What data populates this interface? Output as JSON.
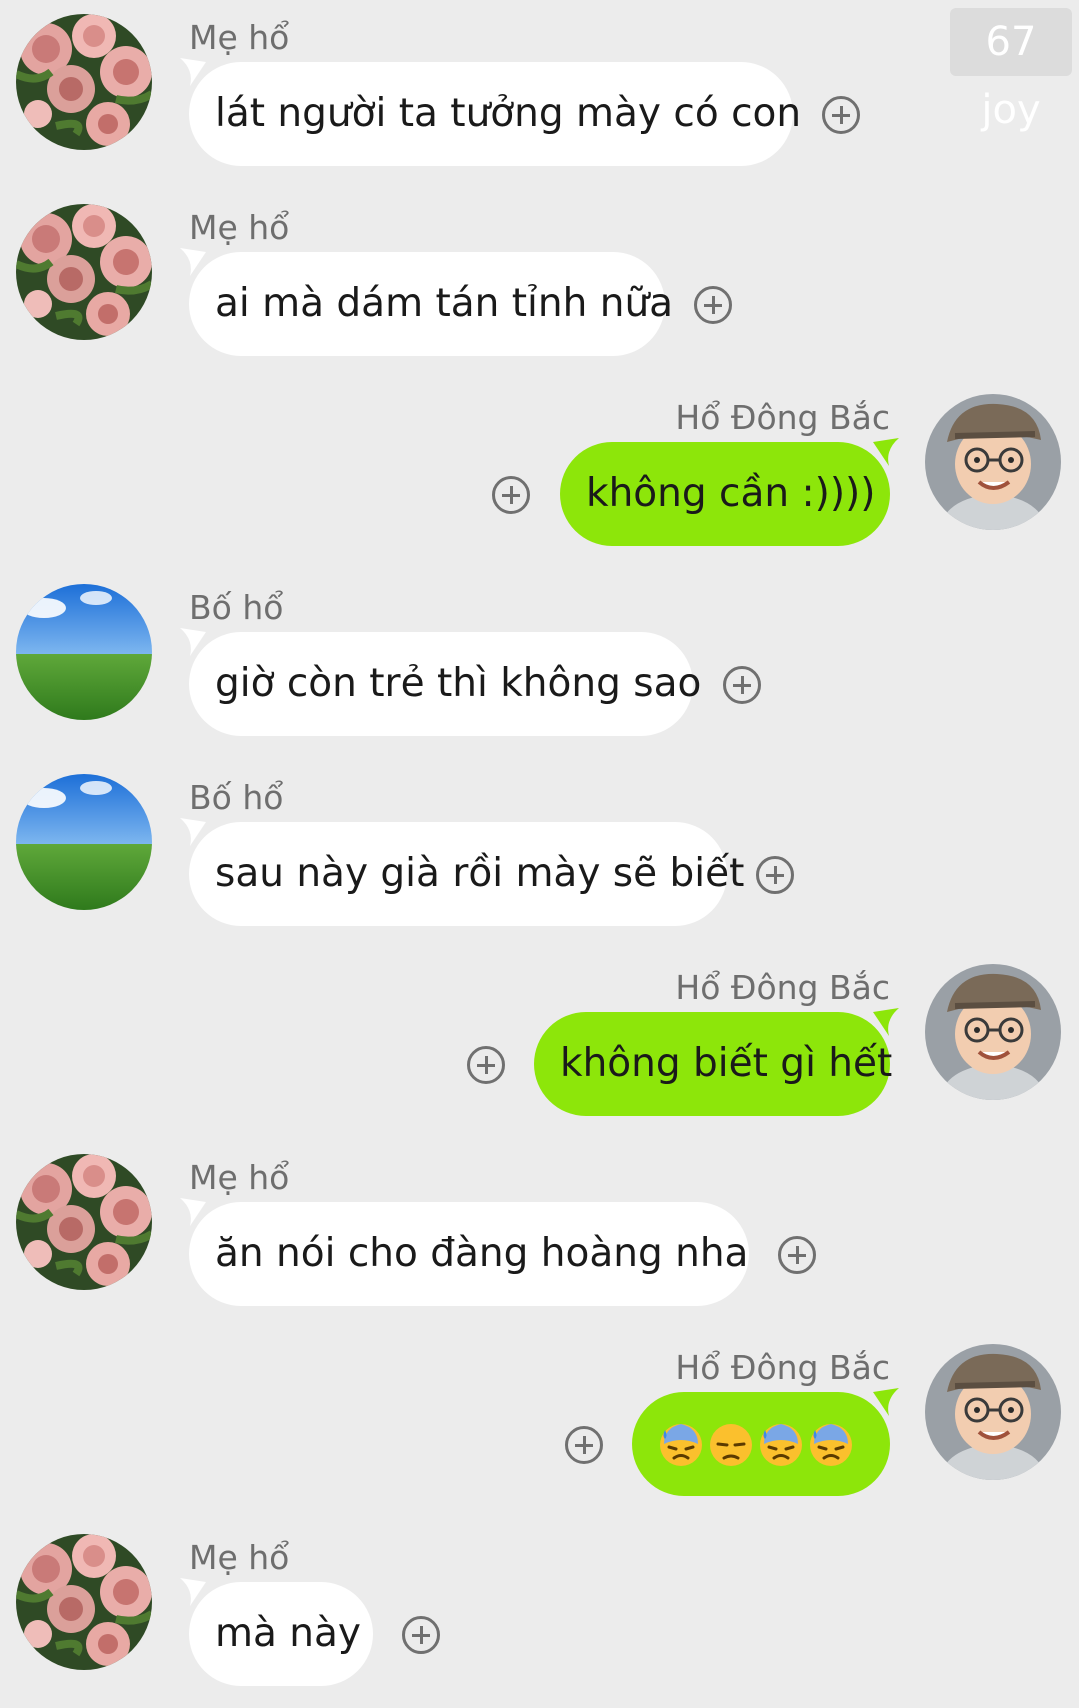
{
  "watermark": "67 joy",
  "messages": [
    {
      "sender": "Mẹ hổ",
      "text": "lát người ta tưởng mày có con",
      "side": "left",
      "avatar": "roses-avatar"
    },
    {
      "sender": "Mẹ hổ",
      "text": "ai mà dám tán tỉnh nữa",
      "side": "left",
      "avatar": "roses-avatar"
    },
    {
      "sender": "Hổ Đông Bắc",
      "text": "không cần :))))",
      "side": "right",
      "avatar": "boy-cap-glasses-avatar"
    },
    {
      "sender": "Bố hổ",
      "text": "giờ còn trẻ thì không sao",
      "side": "left",
      "avatar": "sky-grass-avatar"
    },
    {
      "sender": "Bố hổ",
      "text": "sau này già rồi mày sẽ biết",
      "side": "left",
      "avatar": "sky-grass-avatar"
    },
    {
      "sender": "Hổ Đông Bắc",
      "text": "không biết gì hết",
      "side": "right",
      "avatar": "boy-cap-glasses-avatar"
    },
    {
      "sender": "Mẹ hổ",
      "text": "ăn nói cho đàng hoàng nha",
      "side": "left",
      "avatar": "roses-avatar"
    },
    {
      "sender": "Hổ Đông Bắc",
      "text": "",
      "emojis": [
        "downcast-face-with-sweat-icon",
        "unamused-face-icon",
        "downcast-face-with-sweat-icon",
        "downcast-face-with-sweat-icon"
      ],
      "side": "right",
      "avatar": "boy-cap-glasses-avatar"
    },
    {
      "sender": "Mẹ hổ",
      "text": "mà này",
      "side": "left",
      "avatar": "roses-avatar"
    }
  ],
  "add_reaction_icon": "plus-circle-icon",
  "colors": {
    "background": "#ececec",
    "incoming_bubble": "#ffffff",
    "outgoing_bubble": "#8de60a",
    "sender_name": "#6e6e6e"
  }
}
